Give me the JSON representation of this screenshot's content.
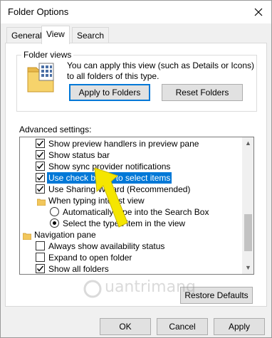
{
  "window": {
    "title": "Folder Options"
  },
  "tabs": [
    {
      "label": "General"
    },
    {
      "label": "View"
    },
    {
      "label": "Search"
    }
  ],
  "folder_views": {
    "group_label": "Folder views",
    "description": "You can apply this view (such as Details or Icons) to all folders of this type.",
    "apply_button": "Apply to Folders",
    "reset_button": "Reset Folders"
  },
  "advanced": {
    "label": "Advanced settings:",
    "items": [
      {
        "label": "Show preview handlers in preview pane",
        "type": "checkbox",
        "checked": true
      },
      {
        "label": "Show status bar",
        "type": "checkbox",
        "checked": true
      },
      {
        "label": "Show sync provider notifications",
        "type": "checkbox",
        "checked": true
      },
      {
        "label": "Use check boxes to select items",
        "type": "checkbox",
        "checked": true,
        "selected": true
      },
      {
        "label": "Use Sharing Wizard (Recommended)",
        "type": "checkbox",
        "checked": true
      },
      {
        "label": "When typing into list view",
        "type": "folder"
      },
      {
        "label": "Automatically type into the Search Box",
        "type": "radio",
        "checked": false
      },
      {
        "label": "Select the typed item in the view",
        "type": "radio",
        "checked": true
      },
      {
        "label": "Navigation pane",
        "type": "folder"
      },
      {
        "label": "Always show availability status",
        "type": "checkbox",
        "checked": false
      },
      {
        "label": "Expand to open folder",
        "type": "checkbox",
        "checked": false
      },
      {
        "label": "Show all folders",
        "type": "checkbox",
        "checked": true
      }
    ],
    "restore_button": "Restore Defaults"
  },
  "footer": {
    "ok": "OK",
    "cancel": "Cancel",
    "apply": "Apply"
  },
  "watermark": "uantrimang",
  "colors": {
    "selection": "#0078d7",
    "annotation_arrow": "#f5e600"
  },
  "icons": [
    "close-icon",
    "folder-views-icon",
    "folder-icon",
    "checkmark-icon",
    "radio-dot-icon",
    "scroll-up-icon",
    "scroll-down-icon",
    "annotation-arrow"
  ]
}
